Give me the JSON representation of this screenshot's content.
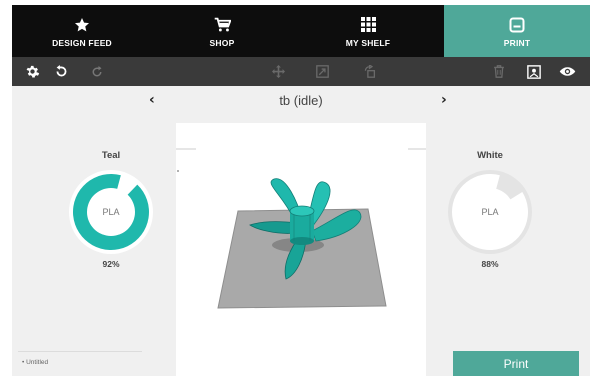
{
  "nav": {
    "tabs": [
      {
        "label": "DESIGN FEED",
        "icon": "star-icon"
      },
      {
        "label": "SHOP",
        "icon": "cart-icon"
      },
      {
        "label": "MY SHELF",
        "icon": "grid-icon"
      },
      {
        "label": "PRINT",
        "icon": "print-icon",
        "active": true
      }
    ]
  },
  "toolbar": {
    "left_icons": [
      "settings-icon",
      "undo-icon",
      "redo-icon"
    ],
    "center_icons": [
      "move-icon",
      "scale-icon",
      "rotate-icon"
    ],
    "right_icons": [
      "delete-icon",
      "layout-icon",
      "view-icon"
    ]
  },
  "printer": {
    "name": "tb (idle)"
  },
  "spools": [
    {
      "name": "Teal",
      "material": "PLA",
      "percent_label": "92%",
      "fraction": 0.92,
      "color": "#1fb8ac"
    },
    {
      "name": "White",
      "material": "PLA",
      "percent_label": "88%",
      "fraction": 0.88,
      "color": "#ffffff"
    }
  ],
  "files": {
    "items": [
      {
        "label": "Untitled"
      }
    ]
  },
  "actions": {
    "print_label": "Print"
  },
  "colors": {
    "accent": "#4fa899",
    "nav_bg": "#0d0d0d",
    "toolbar_bg": "#3a3a3a",
    "model": "#1fb8ac"
  }
}
